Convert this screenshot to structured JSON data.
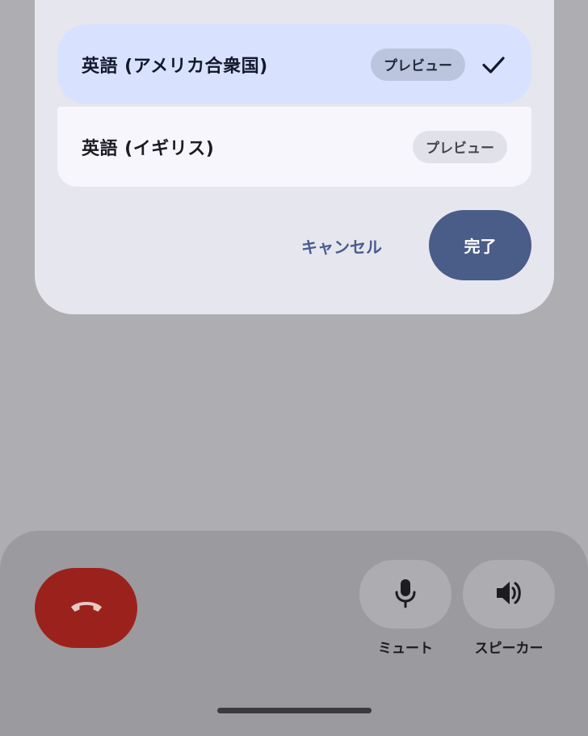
{
  "dialog": {
    "options": [
      {
        "label": "英語 (アメリカ合衆国)",
        "preview_label": "プレビュー",
        "selected": true
      },
      {
        "label": "英語 (イギリス)",
        "preview_label": "プレビュー",
        "selected": false
      }
    ],
    "cancel_label": "キャンセル",
    "done_label": "完了"
  },
  "call_controls": {
    "mute_label": "ミュート",
    "speaker_label": "スピーカー"
  },
  "colors": {
    "selected_option_bg": "#d8e2ff",
    "primary_button": "#4a5c88",
    "hangup_button": "#9b221c"
  },
  "icons": {
    "selected": "check-icon",
    "hangup": "call-end-icon",
    "mute": "microphone-icon",
    "speaker": "speaker-icon"
  }
}
